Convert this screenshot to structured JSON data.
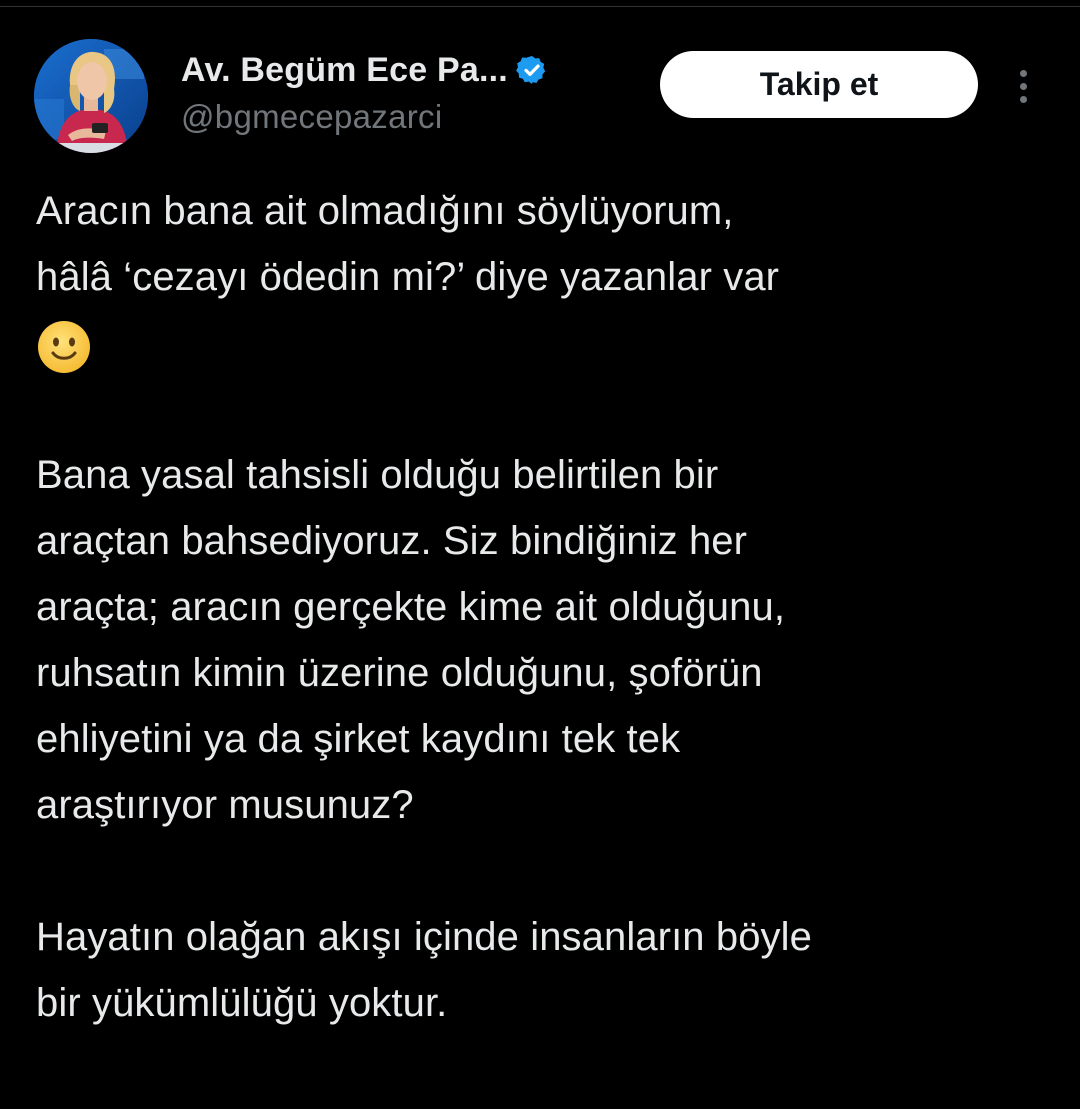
{
  "author": {
    "display_name": "Av. Begüm Ece Pa...",
    "handle": "@bgmecepazarci",
    "verified": true,
    "avatar": "avatar-photo"
  },
  "actions": {
    "follow_label": "Takip et",
    "more_icon": "more-vertical-icon"
  },
  "tweet": {
    "lines": [
      "Aracın bana ait olmadığını söylüyorum,",
      "hâlâ ‘cezayı ödedin mi?’ diye yazanlar var",
      "",
      "",
      "Bana yasal tahsisli olduğu belirtilen bir",
      "araçtan bahsediyoruz. Siz bindiğiniz her",
      "araçta; aracın gerçekte kime ait olduğunu,",
      "ruhsatın kimin üzerine olduğunu, şoförün",
      "ehliyetini ya da şirket kaydını tek tek",
      "araştırıyor musunuz?",
      "",
      "Hayatın olağan akışı içinde insanların böyle",
      "bir yükümlülüğü yoktur."
    ],
    "emoji": "slightly-smiling-face-icon"
  },
  "colors": {
    "background": "#000000",
    "text": "#e7e9ea",
    "secondary_text": "#71767b",
    "verified_badge": "#1d9bf0",
    "button_bg": "#ffffff",
    "button_text": "#0f1419"
  }
}
